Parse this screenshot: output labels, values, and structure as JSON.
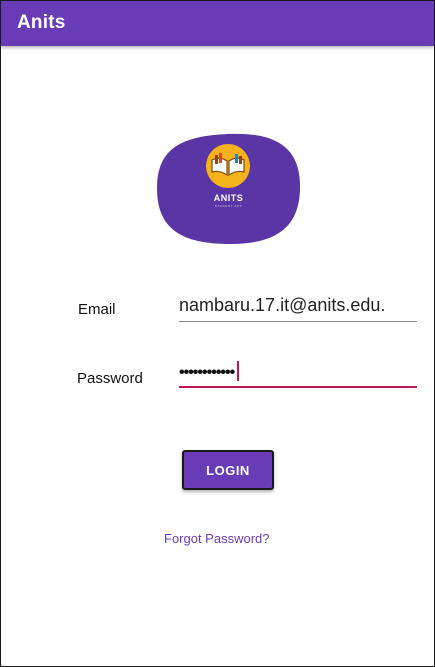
{
  "app_bar": {
    "title": "Anits",
    "color": "#6a3bb7"
  },
  "logo": {
    "icon": "book-icon",
    "title": "ANITS",
    "subtitle": "STUDENT APP",
    "background_color": "#5a35a6",
    "badge_color": "#f5b21a"
  },
  "form": {
    "email_label": "Email",
    "email_value": "nambaru.17.it@anits.edu.",
    "password_label": "Password",
    "password_value": "••••••••••••",
    "focus_color": "#c2185b"
  },
  "actions": {
    "login_label": "LOGIN",
    "forgot_label": "Forgot Password?"
  }
}
